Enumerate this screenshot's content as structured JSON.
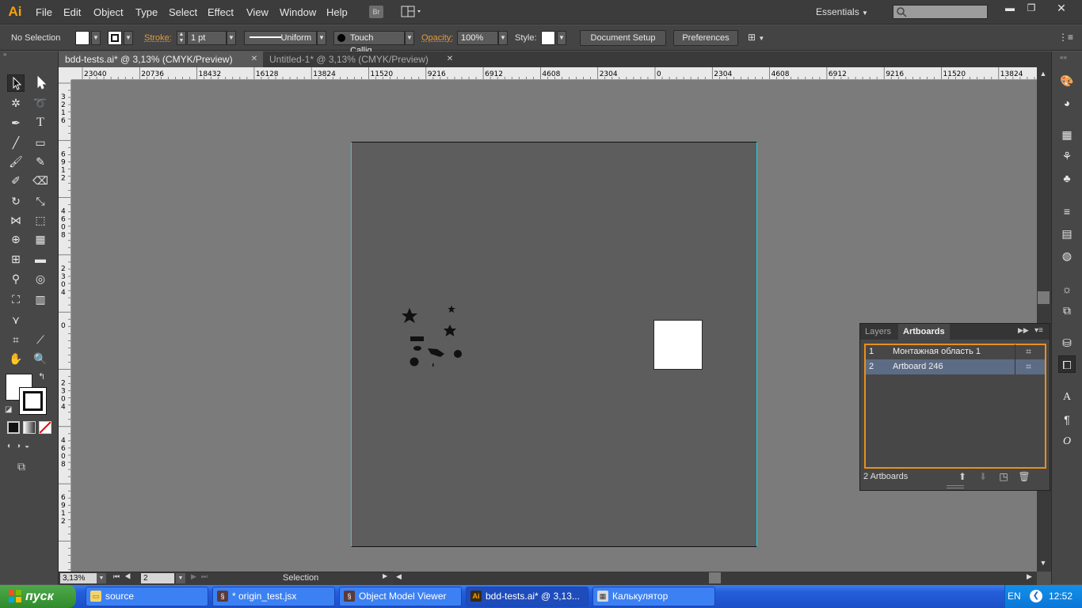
{
  "app": {
    "logo": "Ai"
  },
  "menu": [
    "File",
    "Edit",
    "Object",
    "Type",
    "Select",
    "Effect",
    "View",
    "Window",
    "Help"
  ],
  "toolbar_top": {
    "bridge": "Br",
    "workspace": "Essentials"
  },
  "window_controls": [
    "minimize-icon",
    "restore-icon",
    "close-icon"
  ],
  "control_bar": {
    "selection": "No Selection",
    "stroke_label": "Stroke:",
    "stroke_weight": "1 pt",
    "profile": "Uniform",
    "brush": "Touch Callig...",
    "opacity_label": "Opacity:",
    "opacity": "100%",
    "style_label": "Style:",
    "document_setup": "Document Setup",
    "preferences": "Preferences"
  },
  "tabs": [
    {
      "label": "bdd-tests.ai* @ 3,13% (CMYK/Preview)",
      "active": true
    },
    {
      "label": "Untitled-1* @ 3,13% (CMYK/Preview)",
      "active": false
    }
  ],
  "ruler_top": [
    "23040",
    "20736",
    "18432",
    "16128",
    "13824",
    "11520",
    "9216",
    "6912",
    "4608",
    "2304",
    "0",
    "2304",
    "4608",
    "6912",
    "9216",
    "11520",
    "13824"
  ],
  "ruler_left": [
    "3\n2\n1\n6",
    "6\n9\n1\n2",
    "4\n6\n0\n8",
    "2\n3\n0\n4",
    "0",
    "2\n3\n0\n4",
    "4\n6\n0\n8",
    "6\n9\n1\n2"
  ],
  "status_bar": {
    "zoom": "3,13%",
    "artboard_number": "2",
    "status": "Selection"
  },
  "artboards_panel": {
    "tab_layers": "Layers",
    "tab_artboards": "Artboards",
    "rows": [
      {
        "num": "1",
        "name": "Монтажная область 1"
      },
      {
        "num": "2",
        "name": "Artboard 246"
      }
    ],
    "footer": "2 Artboards"
  },
  "taskbar": {
    "start": "пуск",
    "tasks": [
      {
        "label": "source",
        "icon": "folder-icon"
      },
      {
        "label": "* origin_test.jsx",
        "icon": "script-icon"
      },
      {
        "label": "Object Model Viewer",
        "icon": "script-icon"
      },
      {
        "label": "bdd-tests.ai* @ 3,13...",
        "icon": "illustrator-icon"
      },
      {
        "label": "Калькулятор",
        "icon": "calculator-icon"
      }
    ],
    "lang": "EN",
    "clock": "12:52"
  },
  "colors": {
    "accent_orange": "#e8901c",
    "ai_logo": "#f7a20c",
    "taskbar_blue": "#245edb"
  }
}
